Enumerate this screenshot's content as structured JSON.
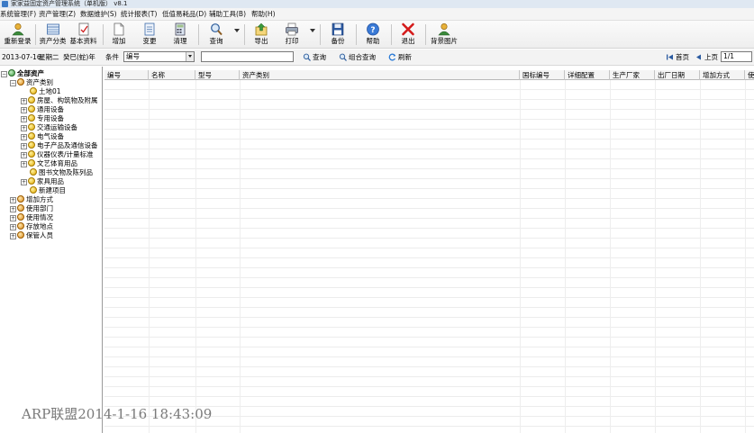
{
  "window": {
    "title": "家家益固定资产管理系统（单机版） v8.1"
  },
  "menu": [
    "系统管理(F)",
    "资产管理(Z)",
    "数据维护(S)",
    "统计报表(T)",
    "低值易耗品(D)",
    "辅助工具(B)",
    "帮助(H)"
  ],
  "toolbar": {
    "relogin": "重新登录",
    "asset_category": "资产分类",
    "basic_data": "基本资料",
    "add": "增加",
    "change": "变更",
    "clear": "清理",
    "query": "查询",
    "export": "导出",
    "print": "打印",
    "backup": "备份",
    "help": "帮助",
    "exit": "退出",
    "background": "背景图片"
  },
  "searchbar": {
    "date": "2013-07-16",
    "weekday": "星期二",
    "lunar": "癸巳(蛇)年",
    "condition_label": "条件",
    "condition_value": "编号",
    "input_value": "",
    "query": "查询",
    "combined_query": "组合查询",
    "refresh": "刷新",
    "first_page": "首页",
    "prev_page": "上页",
    "page_value": "1/1"
  },
  "tree": {
    "root": "全部资产",
    "asset_category": "资产类别",
    "categories": [
      "土地01",
      "房屋、构筑物及附属",
      "通用设备",
      "专用设备",
      "交通运输设备",
      "电气设备",
      "电子产品及通信设备",
      "仪器仪表/计量标准",
      "文艺体育用品",
      "图书文物及陈列品",
      "家具用品",
      "新建项目"
    ],
    "groups": [
      "增加方式",
      "使用部门",
      "使用情况",
      "存放地点",
      "保管人员"
    ]
  },
  "grid": {
    "columns": [
      "编号",
      "名称",
      "型号",
      "资产类别",
      "国标编号",
      "详细配置",
      "生产厂家",
      "出厂日期",
      "增加方式",
      "使"
    ]
  },
  "watermark": "ARP联盟2014-1-16 18:43:09",
  "colors": {
    "accent": "#3b7ac6",
    "node_yellow": "#e1a900",
    "root_green": "#3a9a3a"
  }
}
